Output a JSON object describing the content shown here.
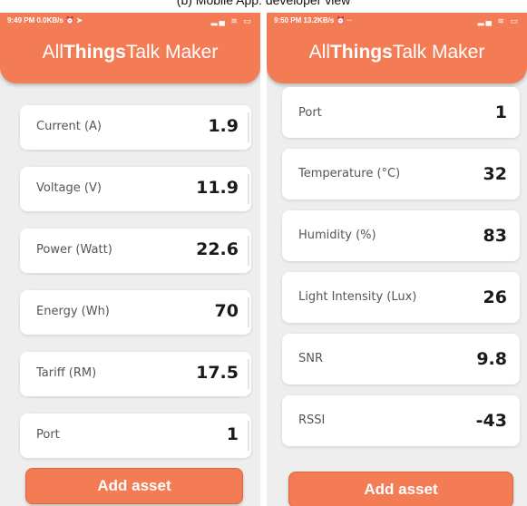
{
  "caption": "(b) Mobile App: developer view",
  "left_phone": {
    "status_time": "9:49 PM",
    "status_speed": "0.0KB/s",
    "brand": {
      "part1": "All",
      "part2": "Things",
      "part3": "Talk Maker"
    },
    "cards": [
      {
        "label": "Current (A)",
        "value": "1.9"
      },
      {
        "label": "Voltage (V)",
        "value": "11.9"
      },
      {
        "label": "Power (Watt)",
        "value": "22.6"
      },
      {
        "label": "Energy (Wh)",
        "value": "70"
      },
      {
        "label": "Tariff (RM)",
        "value": "17.5"
      },
      {
        "label": "Port",
        "value": "1"
      }
    ],
    "add_button": "Add asset"
  },
  "right_phone": {
    "status_time": "9:50 PM",
    "status_speed": "13.2KB/s",
    "brand": {
      "part1": "All",
      "part2": "Things",
      "part3": "Talk Maker"
    },
    "cards": [
      {
        "label": "Port",
        "value": "1"
      },
      {
        "label": "Temperature (°C)",
        "value": "32"
      },
      {
        "label": "Humidity (%)",
        "value": "83"
      },
      {
        "label": "Light Intensity (Lux)",
        "value": "26"
      },
      {
        "label": "SNR",
        "value": "9.8"
      },
      {
        "label": "RSSI",
        "value": "-43"
      }
    ],
    "add_button": "Add asset"
  },
  "colors": {
    "accent": "#f47c55",
    "background": "#eeeeee",
    "card": "#ffffff"
  },
  "icons": [
    "wifi-icon",
    "signal-icon",
    "battery-icon",
    "send-icon",
    "alarm-icon"
  ]
}
